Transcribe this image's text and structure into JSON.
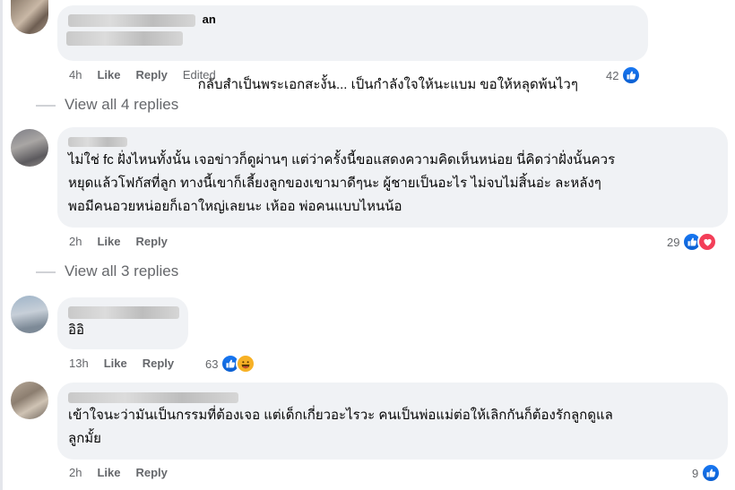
{
  "comments": [
    {
      "author": "an",
      "text": "กลับสำเป็นพระเอกสะงั้น... เป็นกำลังใจให้นะแบม ขอให้หลุดพ้นไวๆ",
      "time": "4h",
      "like_label": "Like",
      "reply_label": "Reply",
      "edited_label": "Edited",
      "reaction_count": "42",
      "reactions": [
        "like-icon"
      ]
    },
    {
      "author": "",
      "text": "ไม่ใช่ fc ฝั่งไหนทั้งนั้น เจอข่าวก็ดูผ่านๆ แต่ว่าครั้งนี้ขอแสดงความคิดเห็นหน่อย นี่คิดว่าฝั่งนั้นควร\nหยุดแล้วโฟกัสที่ลูก ทางนี้เขาก็เลี้ยงลูกของเขามาดีๆนะ ผู้ชายเป็นอะไร ไม่จบไม่สิ้นอ่ะ ละหลังๆ\nพอมีคนอวยหน่อยก็เอาใหญ่เลยนะ เห้ออ พ่อคนแบบไหนน้อ",
      "time": "2h",
      "like_label": "Like",
      "reply_label": "Reply",
      "reaction_count": "29",
      "reactions": [
        "like-icon",
        "love-icon"
      ]
    },
    {
      "author": "",
      "text": "อิอิ",
      "time": "13h",
      "like_label": "Like",
      "reply_label": "Reply",
      "reaction_count": "63",
      "reactions": [
        "like-icon",
        "haha-icon"
      ]
    },
    {
      "author": "",
      "text": "เข้าใจนะว่ามันเป็นกรรมที่ต้องเจอ แต่เด็กเกี่ยวอะไรวะ คนเป็นพ่อแม่ต่อให้เลิกกันก็ต้องรักลูกดูแล\nลูกมั้ย",
      "time": "2h",
      "like_label": "Like",
      "reply_label": "Reply",
      "reaction_count": "9",
      "reactions": [
        "like-icon"
      ]
    }
  ],
  "view_replies": [
    "View all 4 replies",
    "View all 3 replies"
  ],
  "colors": {
    "bubble": "#f0f2f5",
    "secondary_text": "#65676b",
    "like_blue": "#1877f2",
    "love_red": "#f33e58",
    "haha_yellow": "#f7b125"
  }
}
